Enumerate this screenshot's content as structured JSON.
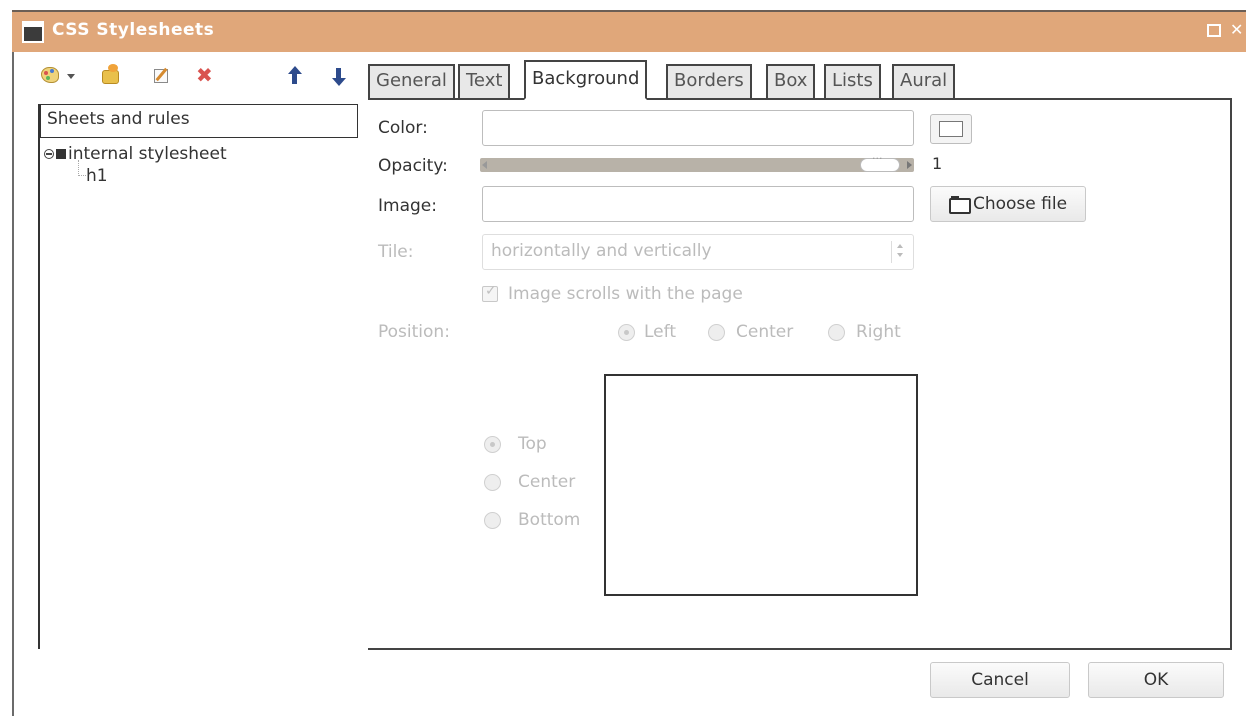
{
  "window": {
    "title": "CSS Stylesheets"
  },
  "tree": {
    "header": "Sheets and rules",
    "items": [
      {
        "label": "internal stylesheet",
        "level": 0
      },
      {
        "label": "h1",
        "level": 1
      }
    ]
  },
  "tabs": [
    "General",
    "Text",
    "Background",
    "Borders",
    "Box",
    "Lists",
    "Aural"
  ],
  "active_tab": "Background",
  "background": {
    "color_label": "Color:",
    "color_value": "",
    "opacity_label": "Opacity:",
    "opacity_value": "1",
    "image_label": "Image:",
    "image_value": "",
    "choose_file_label": "Choose file",
    "tile_label": "Tile:",
    "tile_value": "horizontally and vertically",
    "scroll_label": "Image scrolls with the page",
    "scroll_checked": true,
    "position_label": "Position:",
    "horizontal_options": [
      "Left",
      "Center",
      "Right"
    ],
    "horizontal_selected": "Left",
    "vertical_options": [
      "Top",
      "Center",
      "Bottom"
    ],
    "vertical_selected": "Top"
  },
  "footer": {
    "cancel_label": "Cancel",
    "ok_label": "OK"
  },
  "icons": [
    "stylesheet-palette-icon",
    "dropdown-arrow-icon",
    "import-icon",
    "edit-icon",
    "delete-icon",
    "move-up-icon",
    "move-down-icon",
    "folder-open-icon"
  ]
}
